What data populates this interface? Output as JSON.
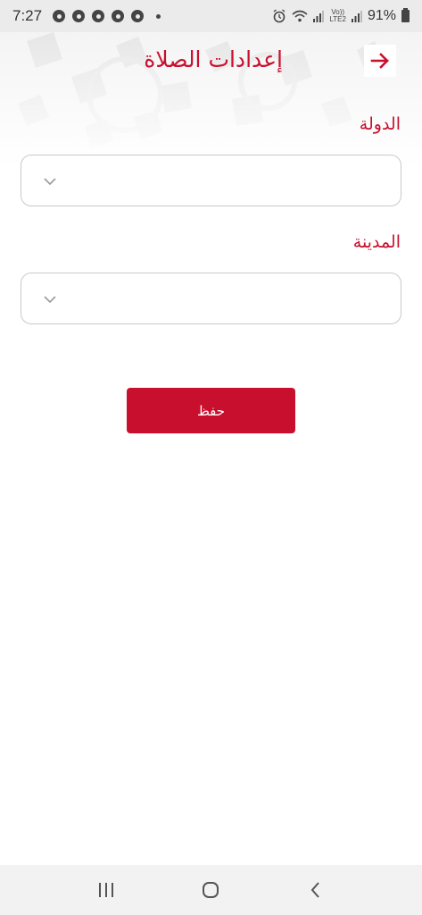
{
  "status_bar": {
    "time": "7:27",
    "battery_percent": "91%",
    "network": "LTE2",
    "volte": "Vo))",
    "notification_icons": [
      "messenger-icon",
      "chrome-icon",
      "chrome-icon",
      "chrome-icon",
      "chrome-icon"
    ]
  },
  "header": {
    "title": "إعدادات الصلاة",
    "back_icon": "arrow-right-icon",
    "accent_color": "#c8102e"
  },
  "form": {
    "country": {
      "label": "الدولة",
      "selected_value": ""
    },
    "city": {
      "label": "المدينة",
      "selected_value": ""
    },
    "save_label": "حفظ"
  },
  "nav_bar": {
    "buttons": [
      "recent-apps-icon",
      "home-icon",
      "back-icon"
    ]
  }
}
